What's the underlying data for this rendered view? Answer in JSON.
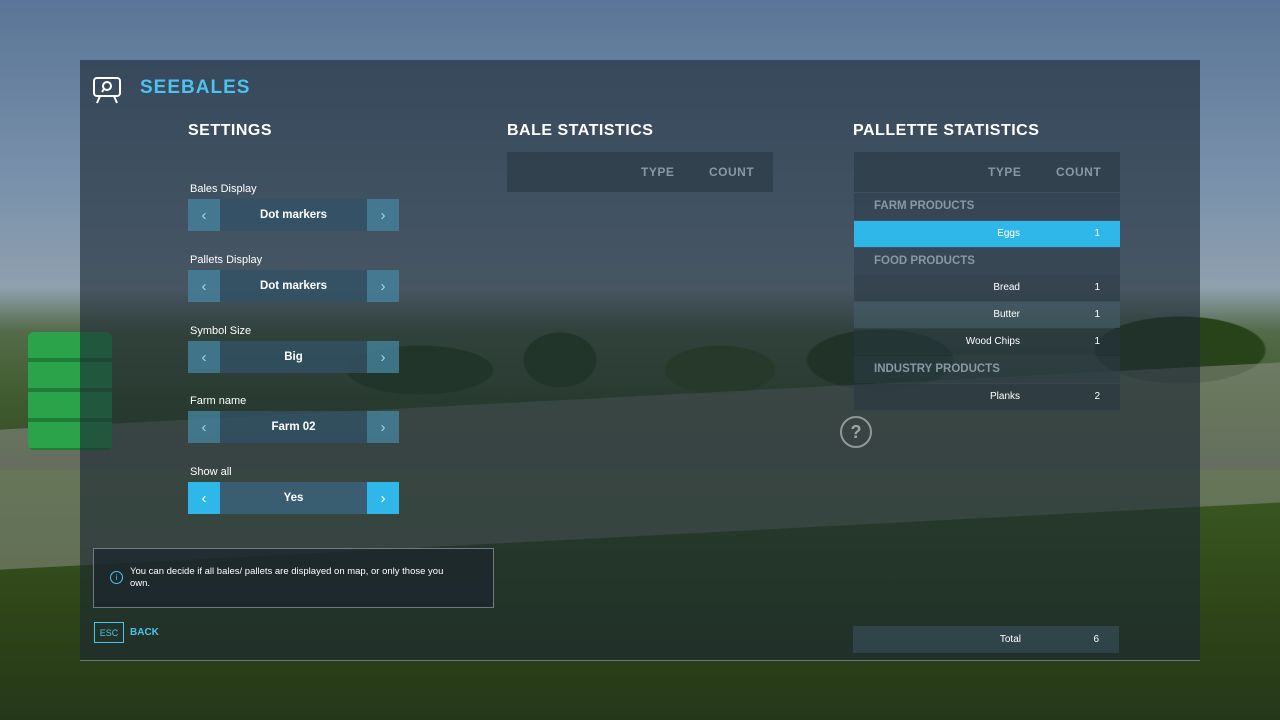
{
  "header": {
    "title": "SEEBALES"
  },
  "settings": {
    "title": "SETTINGS",
    "items": [
      {
        "label": "Bales Display",
        "value": "Dot markers"
      },
      {
        "label": "Pallets Display",
        "value": "Dot markers"
      },
      {
        "label": "Symbol Size",
        "value": "Big"
      },
      {
        "label": "Farm name",
        "value": "Farm 02"
      },
      {
        "label": "Show all",
        "value": "Yes"
      }
    ],
    "arrows": {
      "left": "‹",
      "right": "›"
    }
  },
  "bale_stats": {
    "title": "BALE STATISTICS",
    "col_type": "TYPE",
    "col_count": "COUNT"
  },
  "pallet_stats": {
    "title": "PALLETTE STATISTICS",
    "col_type": "TYPE",
    "col_count": "COUNT",
    "categories": [
      {
        "name": "FARM PRODUCTS",
        "rows": [
          {
            "type": "Eggs",
            "count": "1"
          }
        ]
      },
      {
        "name": "FOOD PRODUCTS",
        "rows": [
          {
            "type": "Bread",
            "count": "1"
          },
          {
            "type": "Butter",
            "count": "1"
          },
          {
            "type": "Wood Chips",
            "count": "1"
          }
        ]
      },
      {
        "name": "INDUSTRY PRODUCTS",
        "rows": [
          {
            "type": "Planks",
            "count": "2"
          }
        ]
      }
    ],
    "total_label": "Total",
    "total_count": "6"
  },
  "tooltip": {
    "text": "You can decide if all bales/ pallets are displayed on map, or only those you own."
  },
  "footer": {
    "esc_key": "ESC",
    "back_label": "BACK"
  },
  "help": {
    "glyph": "?"
  },
  "colors": {
    "accent": "#2fb7ea",
    "title": "#4cc3ee"
  }
}
